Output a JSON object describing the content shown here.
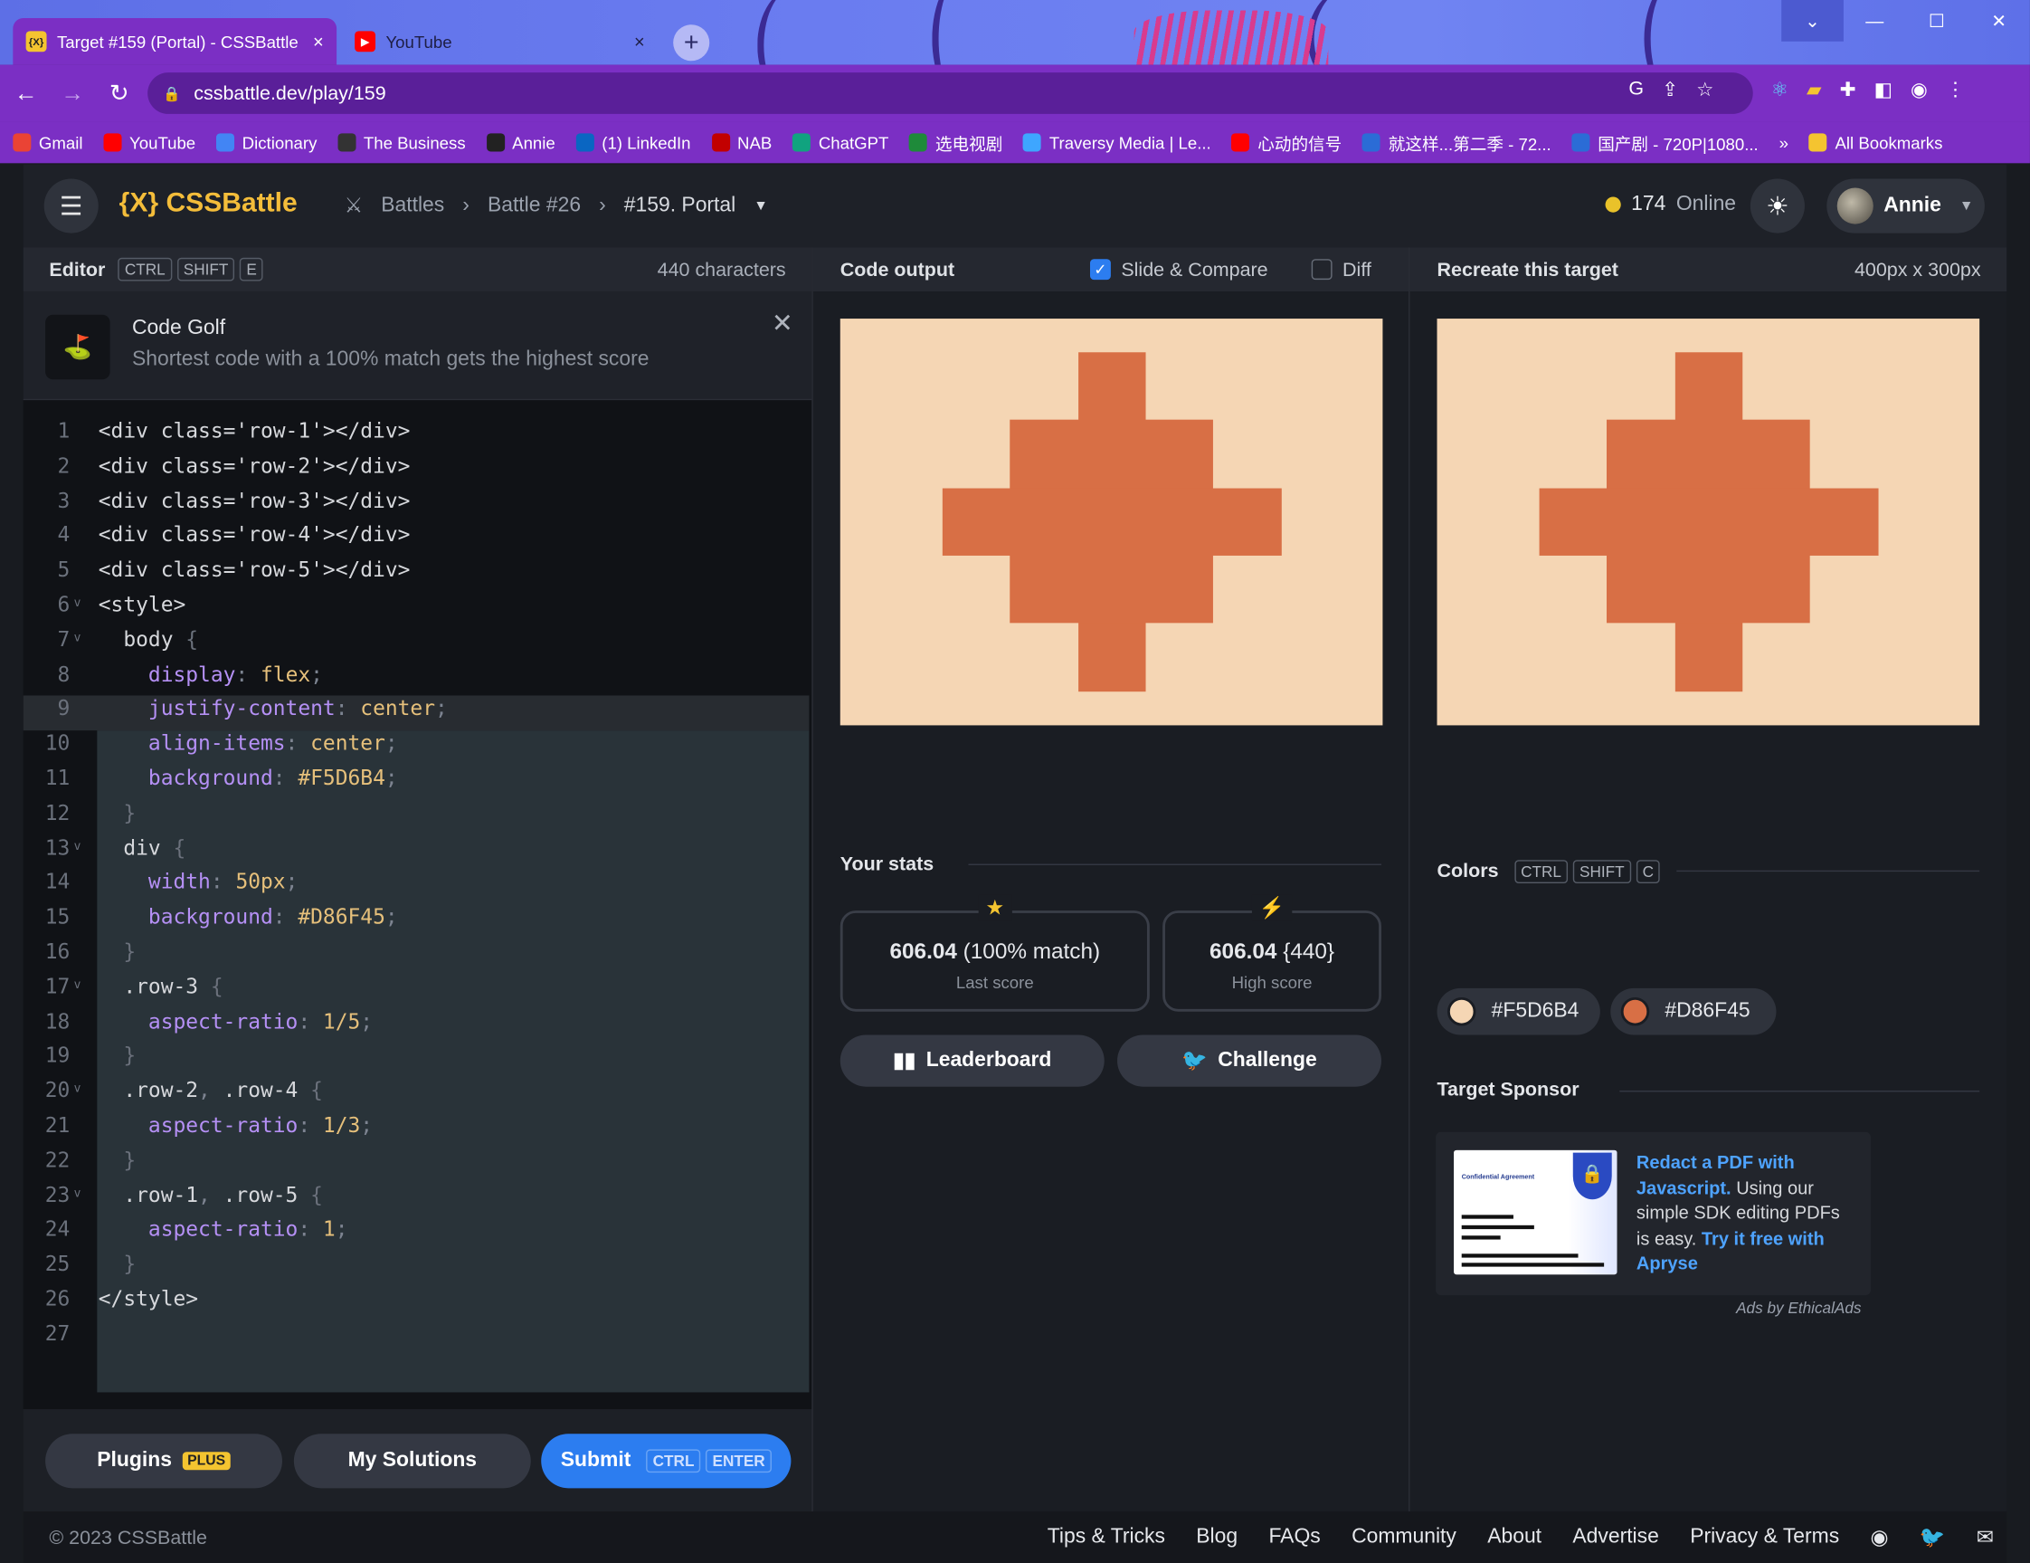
{
  "browser": {
    "tabs": [
      {
        "title": "Target #159 (Portal) - CSSBattle",
        "close": "×"
      },
      {
        "title": "YouTube",
        "close": "×"
      }
    ],
    "new_tab": "+",
    "url": "cssbattle.dev/play/159",
    "window_controls": [
      "⌄",
      "—",
      "☐",
      "✕"
    ],
    "bookmarks": [
      {
        "label": "Gmail",
        "color": "#ea4335"
      },
      {
        "label": "YouTube",
        "color": "#ff0000"
      },
      {
        "label": "Dictionary",
        "color": "#4285f4"
      },
      {
        "label": "The Business",
        "color": "#333333"
      },
      {
        "label": "Annie",
        "color": "#222222"
      },
      {
        "label": "(1) LinkedIn",
        "color": "#0a66c2"
      },
      {
        "label": "NAB",
        "color": "#c20000"
      },
      {
        "label": "ChatGPT",
        "color": "#10a37f"
      },
      {
        "label": "选电视剧",
        "color": "#1e8a3a"
      },
      {
        "label": "Traversy Media | Le...",
        "color": "#3ea6ff"
      },
      {
        "label": "心动的信号",
        "color": "#ff0000"
      },
      {
        "label": "就这样...第二季 - 72...",
        "color": "#2b6cd6"
      },
      {
        "label": "国产剧 - 720P|1080...",
        "color": "#2b6cd6"
      }
    ],
    "more_bookmarks": "»",
    "all_bookmarks": "All Bookmarks"
  },
  "header": {
    "logo": "{X} CSSBattle",
    "breadcrumbs": [
      "Battles",
      "Battle #26",
      "#159. Portal"
    ],
    "online_count": "174",
    "online_label": "Online",
    "user": "Annie"
  },
  "editor": {
    "title": "Editor",
    "shortcut": [
      "CTRL",
      "SHIFT",
      "E"
    ],
    "char_count": "440 characters",
    "golf_title": "Code Golf",
    "golf_subtitle": "Shortest code with a 100% match gets the highest score",
    "lines": [
      "<div class='row-1'></div>",
      "<div class='row-2'></div>",
      "<div class='row-3'></div>",
      "<div class='row-4'></div>",
      "<div class='row-5'></div>",
      "<style>",
      "  body {",
      "    display: flex;",
      "    justify-content: center;",
      "    align-items: center;",
      "    background: #F5D6B4;",
      "  }",
      "  div {",
      "    width: 50px;",
      "    background: #D86F45;",
      "  }",
      "  .row-3 {",
      "    aspect-ratio: 1/5;",
      "  }",
      "  .row-2, .row-4 {",
      "    aspect-ratio: 1/3;",
      "  }",
      "  .row-1, .row-5 {",
      "    aspect-ratio: 1;",
      "  }",
      "</style>",
      ""
    ],
    "plugins_label": "Plugins",
    "plugins_badge": "PLUS",
    "solutions_label": "My Solutions",
    "submit_label": "Submit",
    "submit_shortcut": [
      "CTRL",
      "ENTER"
    ]
  },
  "output": {
    "title": "Code output",
    "slide_compare": "Slide & Compare",
    "slide_compare_checked": true,
    "diff": "Diff",
    "diff_checked": false,
    "stats_title": "Your stats",
    "last_score": "606.04",
    "last_match": "(100% match)",
    "last_label": "Last score",
    "high_score": "606.04",
    "high_chars": "{440}",
    "high_label": "High score",
    "leaderboard": "Leaderboard",
    "challenge": "Challenge"
  },
  "target": {
    "title": "Recreate this target",
    "size": "400px x 300px",
    "colors_title": "Colors",
    "colors_shortcut": [
      "CTRL",
      "SHIFT",
      "C"
    ],
    "colors": [
      "#F5D6B4",
      "#D86F45"
    ],
    "sponsor_title": "Target Sponsor",
    "sponsor_text_link1": "Redact a PDF with Javascript.",
    "sponsor_text_body": " Using our simple SDK editing PDFs is easy. ",
    "sponsor_text_link2": "Try it free with Apryse",
    "sponsor_img_label": "Confidential Agreement",
    "ads_by": "Ads by EthicalAds"
  },
  "footer": {
    "copyright": "© 2023 CSSBattle",
    "links": [
      "Tips & Tricks",
      "Blog",
      "FAQs",
      "Community",
      "About",
      "Advertise",
      "Privacy & Terms"
    ]
  }
}
